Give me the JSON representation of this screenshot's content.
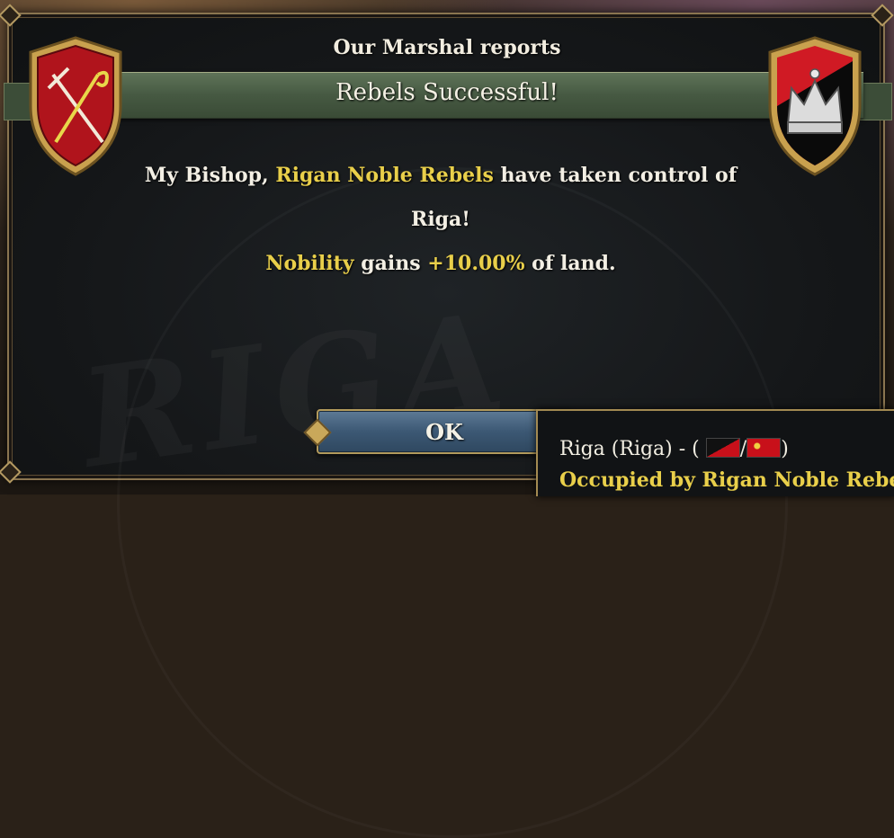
{
  "event": {
    "subtitle": "Our Marshal reports",
    "title": "Rebels Successful!",
    "body": {
      "line1_pre": "My Bishop, ",
      "line1_rebels": "Rigan Noble Rebels",
      "line1_post": " have taken control of",
      "line2": "Riga!",
      "line3_estate": "Nobility",
      "line3_mid": " gains ",
      "line3_value": "+10.00%",
      "line3_post": " of land."
    },
    "ok_label": "OK",
    "watermark": "RIGA"
  },
  "tooltip": {
    "location_prefix": "Riga (Riga) - (",
    "separator": "/",
    "suffix": ")",
    "status": "Occupied by Rigan Noble Rebels"
  },
  "colors": {
    "highlight": "#e9cf4a",
    "banner": "#465942",
    "frame_gold": "#b49a62",
    "button_blue": "#3c5874",
    "shield_red": "#b0141c"
  },
  "icons": {
    "left_shield": "crossed-sword-and-crozier-icon",
    "right_shield": "crown-icon"
  }
}
